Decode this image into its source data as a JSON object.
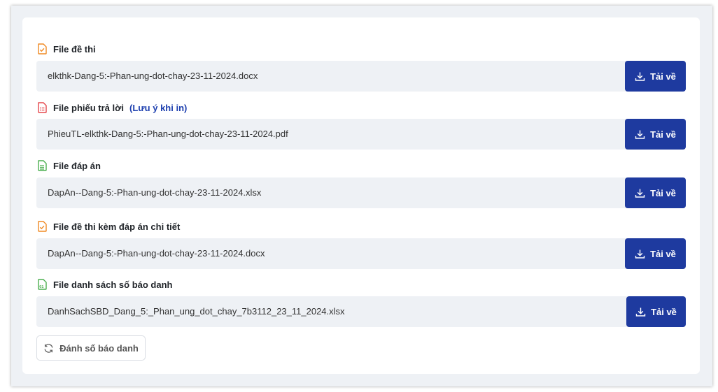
{
  "colors": {
    "accent": "#1e3a9f",
    "row_bg": "#eef1f5",
    "icon_orange": "#f08a24",
    "icon_red": "#e5484d",
    "icon_green": "#4caf50",
    "note_blue": "#1e40af"
  },
  "files": [
    {
      "label": "File đề thi",
      "note": "",
      "icon": "document-orange-icon",
      "filename": "elkthk-Dang-5:-Phan-ung-dot-chay-23-11-2024.docx",
      "button": "Tải về"
    },
    {
      "label": "File phiếu trả lời",
      "note": "(Lưu ý khi in)",
      "icon": "answer-sheet-red-icon",
      "filename": "PhieuTL-elkthk-Dang-5:-Phan-ung-dot-chay-23-11-2024.pdf",
      "button": "Tải về"
    },
    {
      "label": "File đáp án",
      "note": "",
      "icon": "spreadsheet-green-icon",
      "filename": "DapAn--Dang-5:-Phan-ung-dot-chay-23-11-2024.xlsx",
      "button": "Tải về"
    },
    {
      "label": "File đề thi kèm đáp án chi tiết",
      "note": "",
      "icon": "document-orange-icon",
      "filename": "DapAn--Dang-5:-Phan-ung-dot-chay-23-11-2024.docx",
      "button": "Tải về"
    },
    {
      "label": "File danh sách số báo danh",
      "note": "",
      "icon": "spreadsheet-green-icon",
      "filename": "DanhSachSBD_Dang_5:_Phan_ung_dot_chay_7b3112_23_11_2024.xlsx",
      "button": "Tải về"
    }
  ],
  "renumber_button": "Đánh số báo danh"
}
